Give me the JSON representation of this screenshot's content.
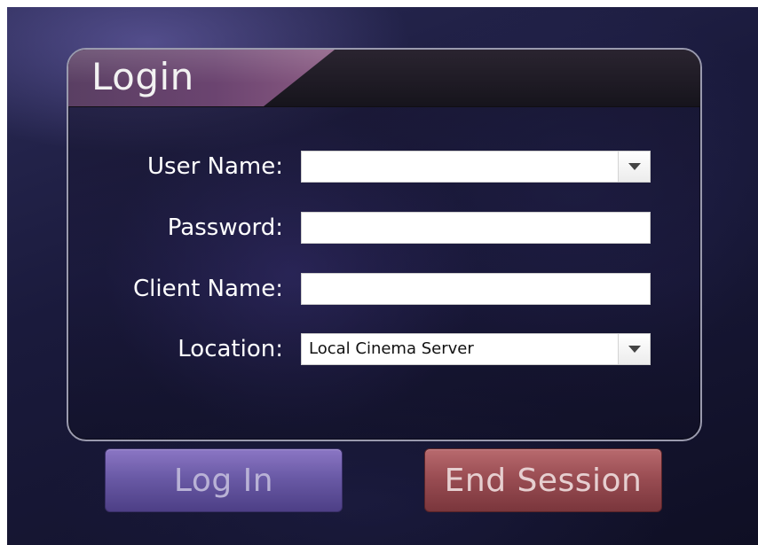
{
  "panel": {
    "title": "Login"
  },
  "form": {
    "username": {
      "label": "User Name:",
      "value": ""
    },
    "password": {
      "label": "Password:",
      "value": ""
    },
    "client_name": {
      "label": "Client Name:",
      "value": ""
    },
    "location": {
      "label": "Location:",
      "selected": "Local Cinema Server"
    }
  },
  "buttons": {
    "login_label": "Log In",
    "end_session_label": "End Session"
  },
  "icons": {
    "dropdown": "chevron-down-icon"
  },
  "colors": {
    "login_button": "#6a5aa6",
    "end_session_button": "#9a4d53",
    "panel_border": "#9a9aae",
    "header_tab": "#6b4470"
  }
}
